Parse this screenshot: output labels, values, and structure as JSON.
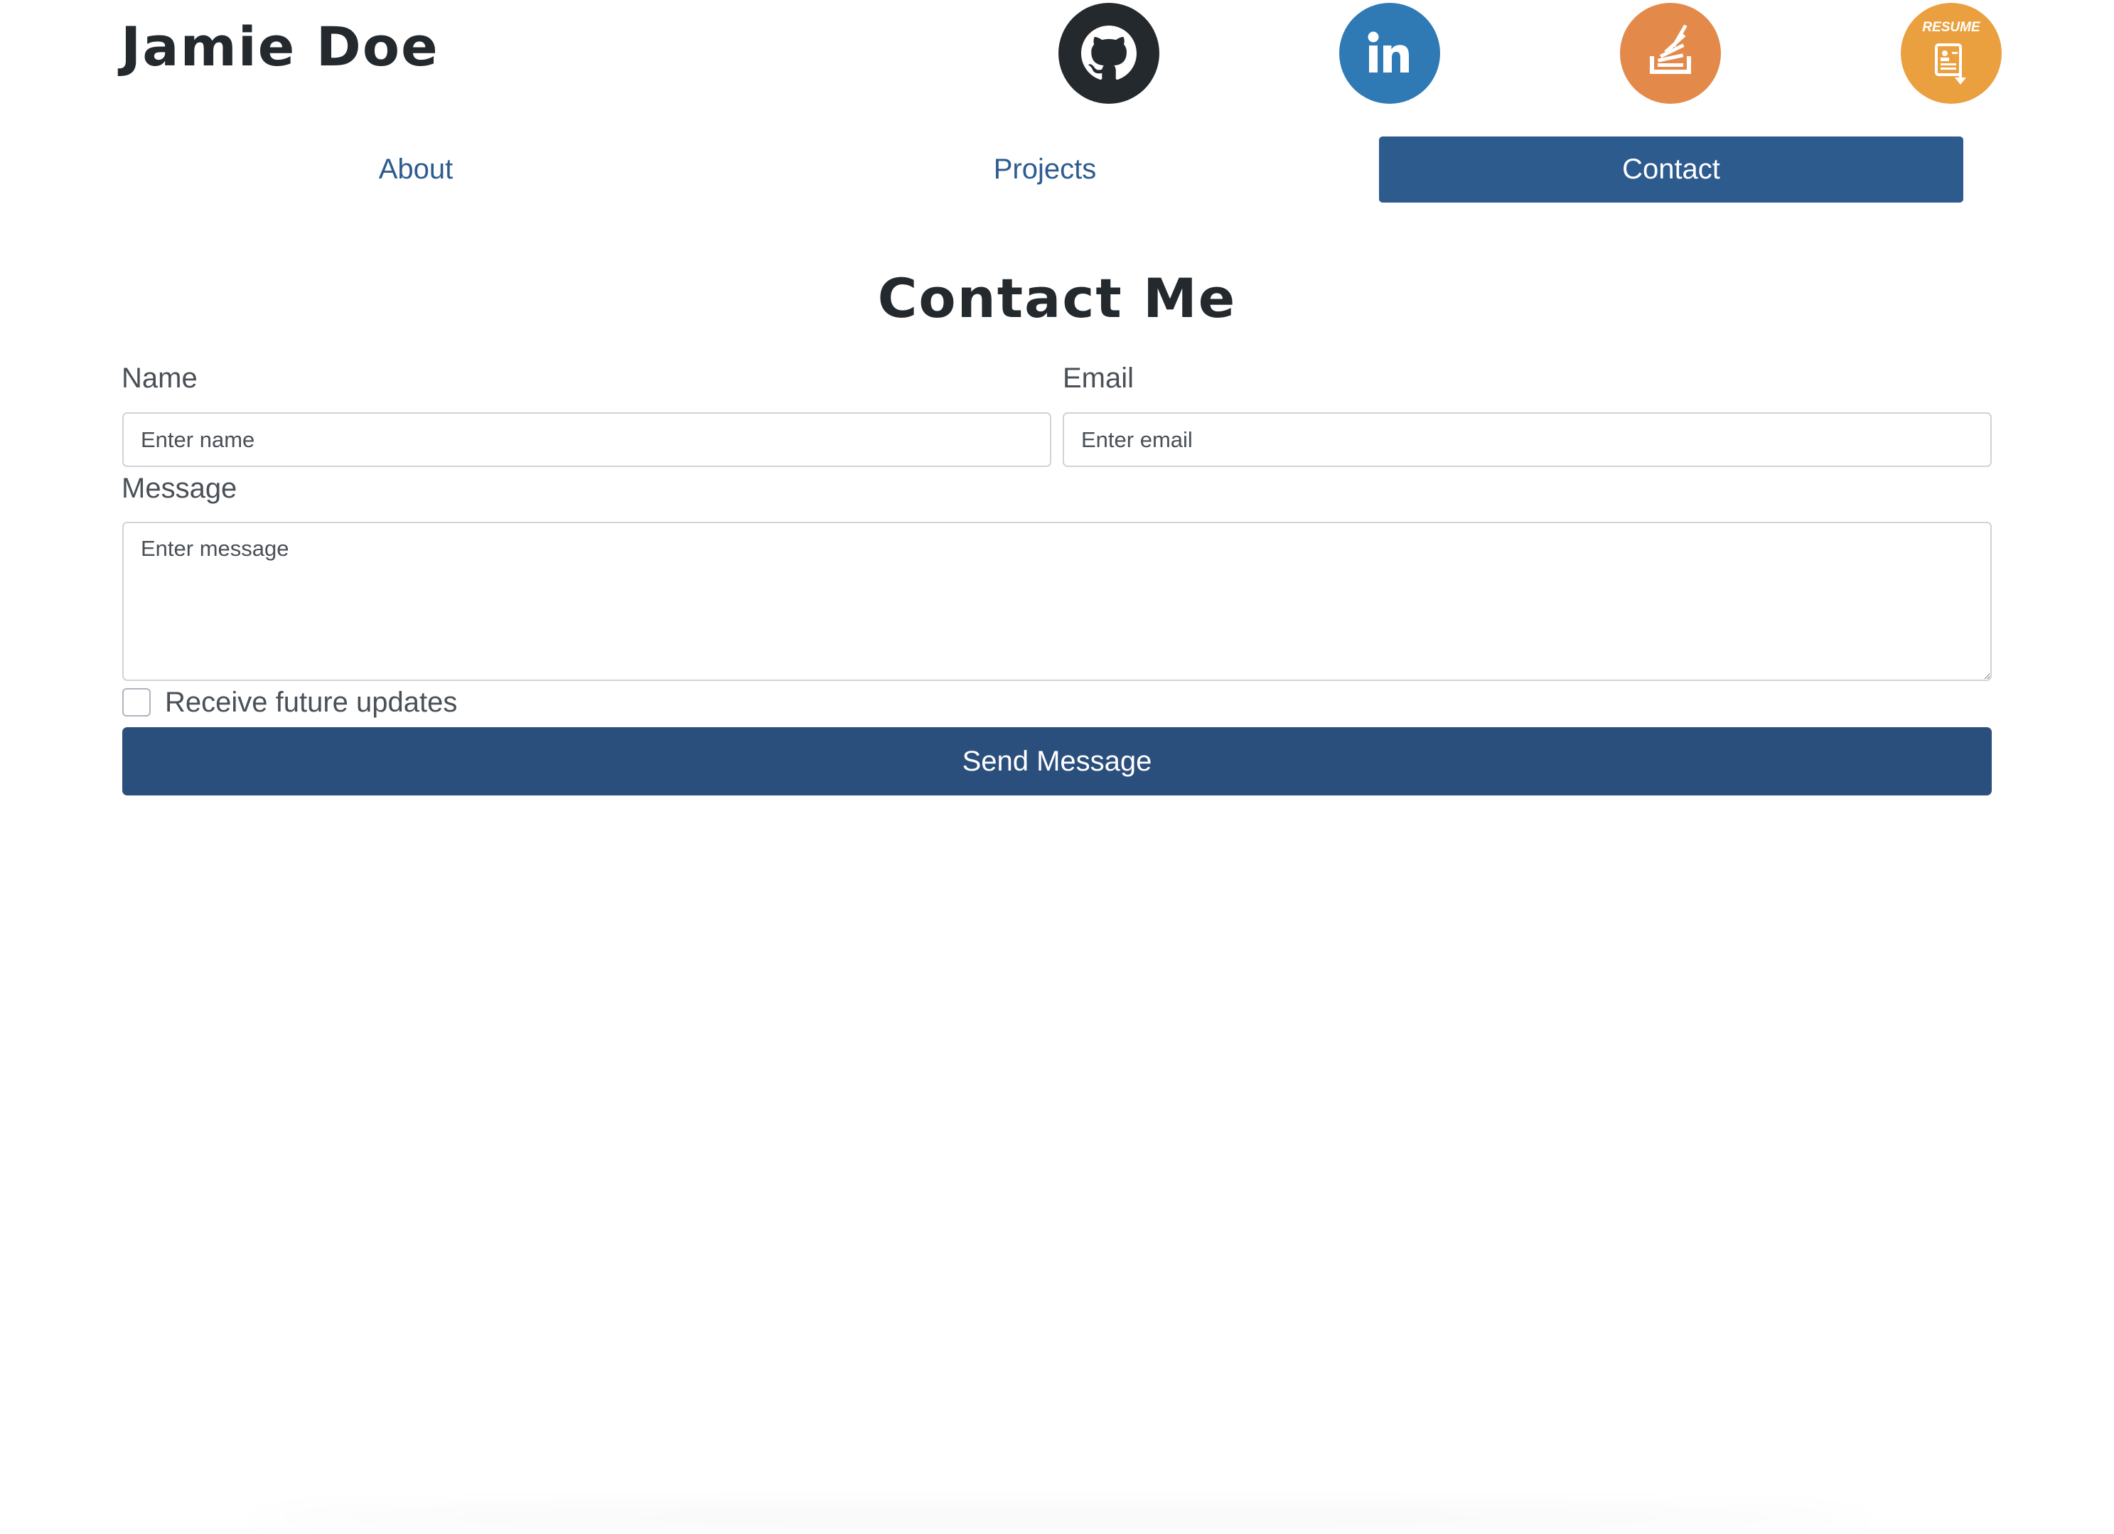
{
  "header": {
    "brand": "Jamie Doe",
    "social": [
      {
        "name": "github",
        "icon": "github-icon",
        "color": "#24292e"
      },
      {
        "name": "linkedin",
        "icon": "linkedin-icon",
        "color": "#2f7ab5"
      },
      {
        "name": "stackoverflow",
        "icon": "stackoverflow-icon",
        "color": "#e38a4b"
      },
      {
        "name": "resume",
        "icon": "resume-icon",
        "label": "RESUME",
        "color": "#eba040"
      }
    ]
  },
  "nav": {
    "tabs": [
      {
        "label": "About",
        "active": false
      },
      {
        "label": "Projects",
        "active": false
      },
      {
        "label": "Contact",
        "active": true
      }
    ],
    "active_color": "#2e5b8e"
  },
  "main": {
    "title": "Contact Me",
    "form": {
      "name_label": "Name",
      "name_placeholder": "Enter name",
      "name_value": "",
      "email_label": "Email",
      "email_placeholder": "Enter email",
      "email_value": "",
      "message_label": "Message",
      "message_placeholder": "Enter message",
      "message_value": "",
      "updates_label": "Receive future updates",
      "updates_checked": false,
      "submit_label": "Send Message",
      "submit_color": "#2b4f7c"
    }
  }
}
